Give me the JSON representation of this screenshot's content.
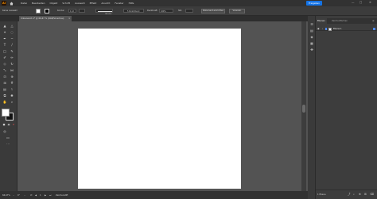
{
  "menubar": {
    "logo": "Ai",
    "items": [
      "Datei",
      "Bearbeiten",
      "Objekt",
      "Schrift",
      "Auswahl",
      "Effekt",
      "Ansicht",
      "Fenster",
      "Hilfe"
    ],
    "share_label": "Freigeben"
  },
  "control": {
    "selection_label": "Keine Auswahl",
    "stroke_label": "Kontur:",
    "stroke_value": "1 pt",
    "brush_label": "Gleichm.",
    "style_label": "5 Punkt Rund",
    "opacity_label": "Deckkraft:",
    "opacity_value": "100%",
    "style_tag": "Stil:",
    "doc_setup_label": "Dokument einrichten",
    "preferences_label": "Voreinst."
  },
  "document_tab": {
    "title": "Unbenannt-1* @ 66,67 % (RGB/Vorschau)"
  },
  "statusbar": {
    "zoom": "66,67%",
    "angle": "0°",
    "artboard_num": "1",
    "tool": "Zeichenstift"
  },
  "layers_panel": {
    "tabs": [
      "Ebenen",
      "Zeichenflächen"
    ],
    "layer_name": "Ebene 1",
    "count_label": "1 Ebene"
  }
}
